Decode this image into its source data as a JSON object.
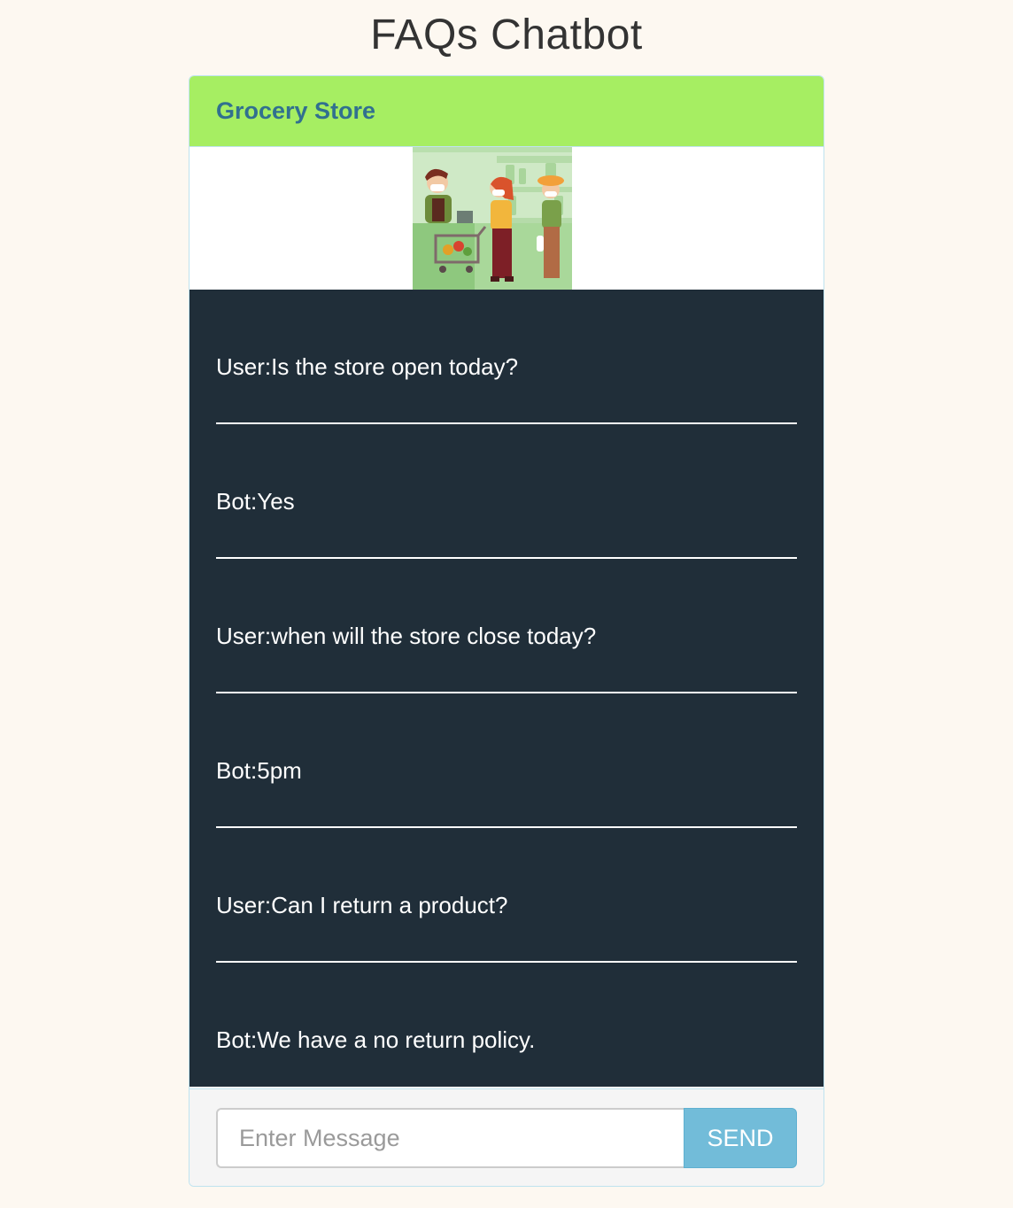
{
  "page": {
    "title": "FAQs Chatbot"
  },
  "panel": {
    "title": "Grocery Store",
    "colors": {
      "header_bg": "#a6ee62",
      "header_text": "#31708f",
      "chat_bg": "#202e39",
      "send_button_bg": "#72bcd9"
    }
  },
  "chat": {
    "messages": [
      {
        "text": "User:Is the store open today?"
      },
      {
        "text": "Bot:Yes"
      },
      {
        "text": "User:when will the store close today?"
      },
      {
        "text": "Bot:5pm"
      },
      {
        "text": "User:Can I return a product?"
      },
      {
        "text": "Bot:We have a no return policy."
      }
    ]
  },
  "composer": {
    "placeholder": "Enter Message",
    "value": "",
    "send_label": "SEND"
  }
}
